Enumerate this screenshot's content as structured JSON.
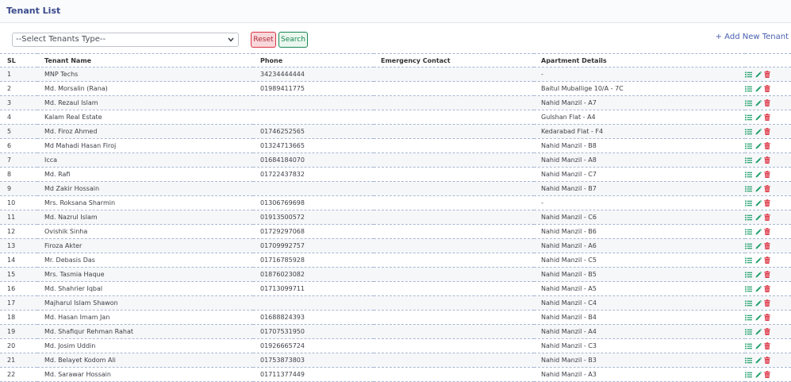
{
  "page": {
    "title": "Tenant List"
  },
  "filters": {
    "select_placeholder": "--Select Tenants Type--",
    "reset_label": "Reset",
    "search_label": "Search",
    "add_new_label": "+ Add New Tenant"
  },
  "table": {
    "headers": {
      "sl": "SL",
      "name": "Tenant Name",
      "phone": "Phone",
      "emergency": "Emergency Contact",
      "apartment": "Apartment Details"
    },
    "rows": [
      {
        "sl": "1",
        "name": "MNP Techs",
        "phone": "34234444444",
        "emergency": "",
        "apartment": "-"
      },
      {
        "sl": "2",
        "name": "Md. Morsalin (Rana)",
        "phone": "01989411775",
        "emergency": "",
        "apartment": "Baitul Muballige 10/A - 7C"
      },
      {
        "sl": "3",
        "name": "Md. Rezaul Islam",
        "phone": "",
        "emergency": "",
        "apartment": "Nahid Manzil - A7"
      },
      {
        "sl": "4",
        "name": "Kalam Real Estate",
        "phone": "",
        "emergency": "",
        "apartment": "Gulshan Flat - A4"
      },
      {
        "sl": "5",
        "name": "Md. Firoz Ahmed",
        "phone": "01746252565",
        "emergency": "",
        "apartment": "Kedarabad Flat - F4"
      },
      {
        "sl": "6",
        "name": "Md Mahadi Hasan Firoj",
        "phone": "01324713665",
        "emergency": "",
        "apartment": "Nahid Manzil - B8"
      },
      {
        "sl": "7",
        "name": "Icca",
        "phone": "01684184070",
        "emergency": "",
        "apartment": "Nahid Manzil - A8"
      },
      {
        "sl": "8",
        "name": "Md. Rafi",
        "phone": "01722437832",
        "emergency": "",
        "apartment": "Nahid Manzil - C7"
      },
      {
        "sl": "9",
        "name": "Md Zakir Hossain",
        "phone": "",
        "emergency": "",
        "apartment": "Nahid Manzil - B7"
      },
      {
        "sl": "10",
        "name": "Mrs. Roksana Sharmin",
        "phone": "01306769698",
        "emergency": "",
        "apartment": "-"
      },
      {
        "sl": "11",
        "name": "Md. Nazrul Islam",
        "phone": "01913500572",
        "emergency": "",
        "apartment": "Nahid Manzil - C6"
      },
      {
        "sl": "12",
        "name": "Ovishik Sinha",
        "phone": "01729297068",
        "emergency": "",
        "apartment": "Nahid Manzil - B6"
      },
      {
        "sl": "13",
        "name": "Firoza Akter",
        "phone": "01709992757",
        "emergency": "",
        "apartment": "Nahid Manzil - A6"
      },
      {
        "sl": "14",
        "name": "Mr. Debasis Das",
        "phone": "01716785928",
        "emergency": "",
        "apartment": "Nahid Manzil - C5"
      },
      {
        "sl": "15",
        "name": "Mrs. Tasmia Haque",
        "phone": "01876023082",
        "emergency": "",
        "apartment": "Nahid Manzil - B5"
      },
      {
        "sl": "16",
        "name": "Md. Shahrier Iqbal",
        "phone": "01713099711",
        "emergency": "",
        "apartment": "Nahid Manzil - A5"
      },
      {
        "sl": "17",
        "name": "Majharul Islam Shawon",
        "phone": "",
        "emergency": "",
        "apartment": "Nahid Manzil - C4"
      },
      {
        "sl": "18",
        "name": "Md. Hasan Imam Jan",
        "phone": "01688824393",
        "emergency": "",
        "apartment": "Nahid Manzil - B4"
      },
      {
        "sl": "19",
        "name": "Md. Shafiqur Rehman Rahat",
        "phone": "01707531950",
        "emergency": "",
        "apartment": "Nahid Manzil - A4"
      },
      {
        "sl": "20",
        "name": "Md. Josim Uddin",
        "phone": "01926665724",
        "emergency": "",
        "apartment": "Nahid Manzil - C3"
      },
      {
        "sl": "21",
        "name": "Md. Belayet Kodom Ali",
        "phone": "01753873803",
        "emergency": "",
        "apartment": "Nahid Manzil - B3"
      },
      {
        "sl": "22",
        "name": "Md. Sarawar Hossain",
        "phone": "01711377449",
        "emergency": "",
        "apartment": "Nahid Manzil - A3"
      }
    ],
    "row_actions": [
      "list-icon",
      "edit-icon",
      "delete-icon"
    ]
  },
  "colors": {
    "title": "#3a4a8c",
    "link": "#4a60b0",
    "danger": "#dc3545",
    "success": "#198754",
    "view_icon": "#1e9e6a",
    "edit_icon": "#1e9e6a",
    "delete_icon": "#dc3545"
  }
}
